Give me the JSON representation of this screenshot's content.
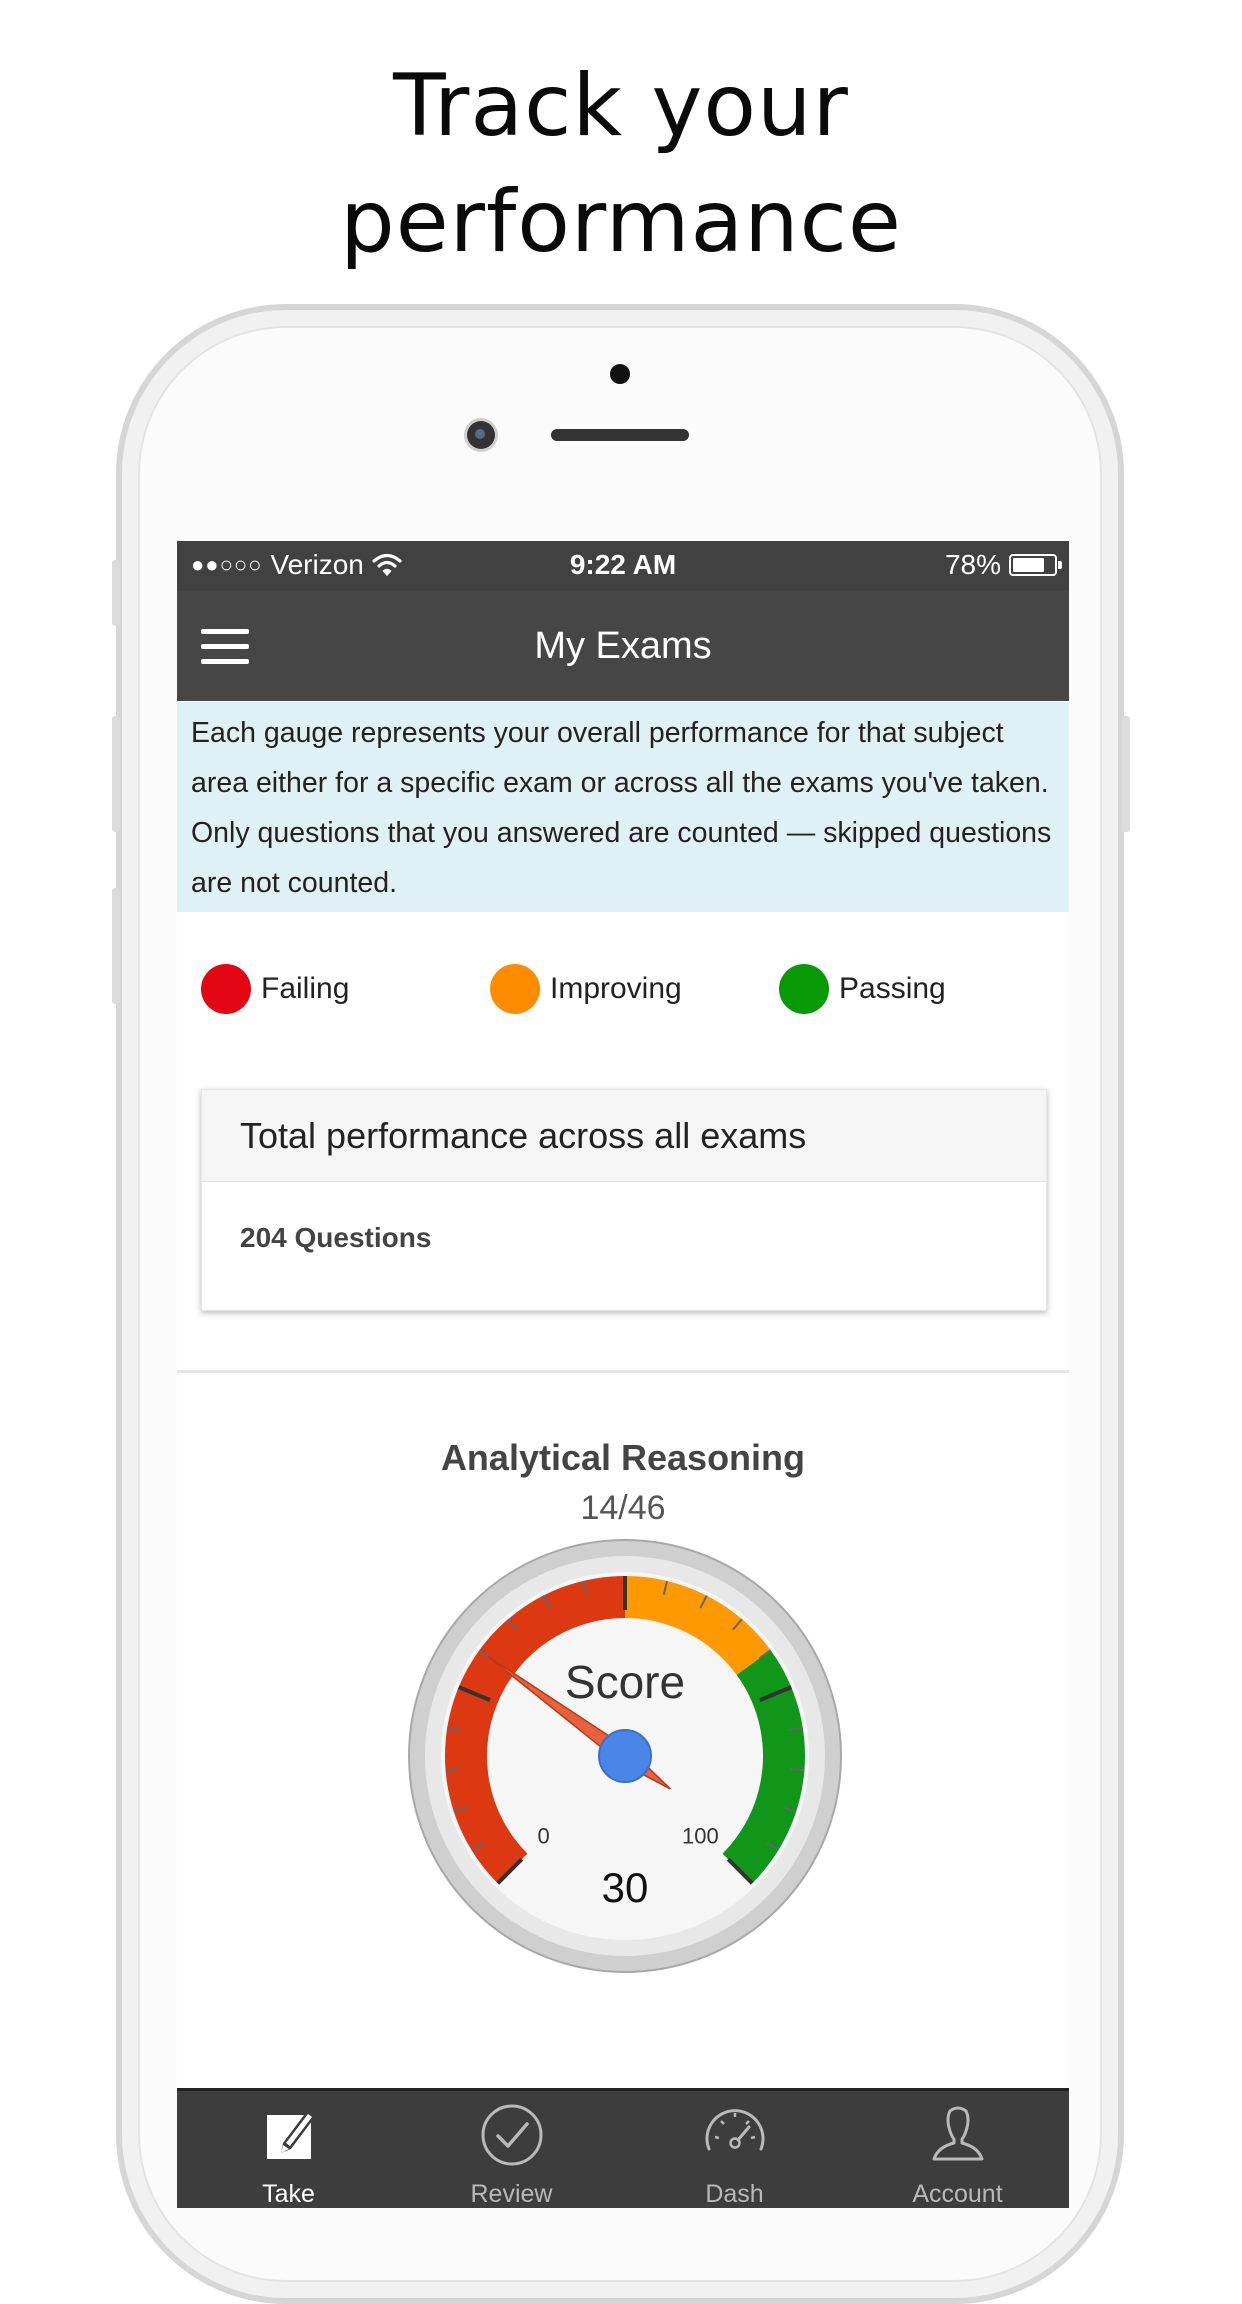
{
  "headline": {
    "line1": "Track your",
    "line2": "performance"
  },
  "status_bar": {
    "carrier": "Verizon",
    "signal": "●●○○○",
    "time": "9:22 AM",
    "battery": "78%",
    "battery_level": 0.78
  },
  "navbar": {
    "title": "My Exams"
  },
  "info_text": "Each gauge represents your overall performance for that subject area either for a specific exam or across all the exams you've taken. Only questions that you answered are counted — skipped questions are not counted.",
  "legend": [
    {
      "label": "Failing",
      "color": "#e30613"
    },
    {
      "label": "Improving",
      "color": "#ff8c00"
    },
    {
      "label": "Passing",
      "color": "#089a06"
    }
  ],
  "total_card": {
    "title": "Total performance across all exams",
    "questions": "204 Questions"
  },
  "subject": {
    "name": "Analytical Reasoning",
    "fraction": "14/46",
    "gauge": {
      "label": "Score",
      "min_label": "0",
      "max_label": "100",
      "min": 0,
      "max": 100,
      "value": 30,
      "value_label": "30",
      "bands": [
        {
          "from": 0,
          "to": 50,
          "color": "#dc3912"
        },
        {
          "from": 50,
          "to": 70,
          "color": "#ff9900"
        },
        {
          "from": 70,
          "to": 100,
          "color": "#109618"
        }
      ]
    }
  },
  "tabs": [
    {
      "label": "Take",
      "icon": "edit-icon",
      "active": true
    },
    {
      "label": "Review",
      "icon": "check-circle-icon",
      "active": false
    },
    {
      "label": "Dash",
      "icon": "speedometer-icon",
      "active": false
    },
    {
      "label": "Account",
      "icon": "user-icon",
      "active": false
    }
  ]
}
